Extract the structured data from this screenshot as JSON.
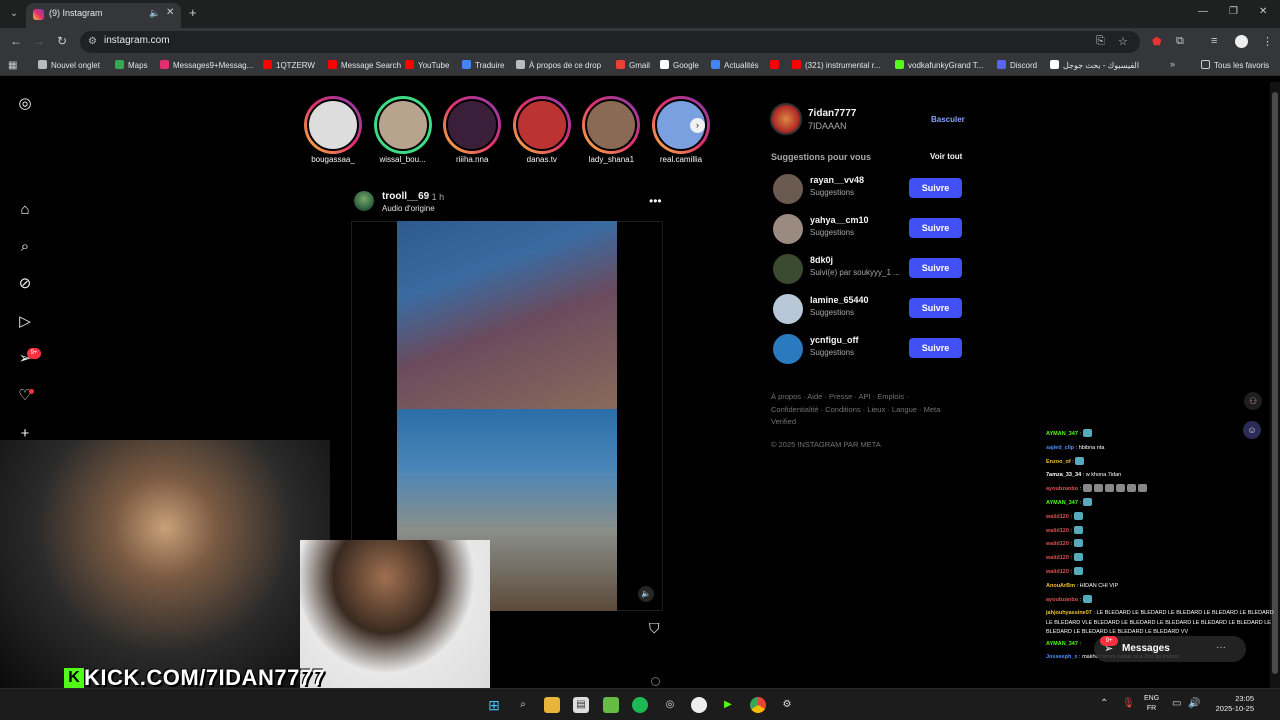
{
  "browser": {
    "tab_title": "(9) Instagram",
    "url": "instagram.com",
    "bookmarks": [
      {
        "label": "Nouvel onglet",
        "color": "#bbbbbb"
      },
      {
        "label": "Maps",
        "color": "#34a853"
      },
      {
        "label": "Messages9+Messag...",
        "color": "#e1306c"
      },
      {
        "label": "1QTZERW",
        "color": "#ff0000"
      },
      {
        "label": "Message Search",
        "color": "#ff0000"
      },
      {
        "label": "YouTube",
        "color": "#ff0000"
      },
      {
        "label": "Traduire",
        "color": "#4285f4"
      },
      {
        "label": "À propos de ce drop",
        "color": "#bbbbbb"
      },
      {
        "label": "Gmail",
        "color": "#ea4335"
      },
      {
        "label": "Google",
        "color": "#ffffff"
      },
      {
        "label": "Actualités",
        "color": "#4285f4"
      },
      {
        "label": "",
        "color": "#ff0000"
      },
      {
        "label": "(321) instrumental r...",
        "color": "#ff0000"
      },
      {
        "label": "vodkafunkyGrand T...",
        "color": "#53fc18"
      },
      {
        "label": "Discord",
        "color": "#5865f2"
      },
      {
        "label": "الفيسبوك - بحث جوجل",
        "color": "#ffffff"
      }
    ],
    "all_bookmarks": "Tous les favoris"
  },
  "stories": [
    {
      "name": "bougassaa_",
      "ring": "linear-gradient(45deg,#f9c13a,#e1306c,#833ab4)",
      "fill": "#ddd"
    },
    {
      "name": "wissal_bou...",
      "ring": "#3ddc84",
      "fill": "#b8a48e"
    },
    {
      "name": "riiiha.nna",
      "ring": "linear-gradient(45deg,#f9c13a,#e1306c,#833ab4)",
      "fill": "#3a1e3a"
    },
    {
      "name": "danas.tv",
      "ring": "linear-gradient(45deg,#f9c13a,#e1306c,#833ab4)",
      "fill": "#b33"
    },
    {
      "name": "lady_shana1",
      "ring": "linear-gradient(45deg,#f9c13a,#e1306c,#833ab4)",
      "fill": "#8a6a55"
    },
    {
      "name": "real.camillia",
      "ring": "linear-gradient(45deg,#f9c13a,#e1306c,#833ab4)",
      "fill": "#7aa0e0"
    }
  ],
  "post": {
    "username": "trooll__69",
    "time": "• 1 h",
    "audio": "Audio d'origine"
  },
  "profile": {
    "username": "7idan7777",
    "name": "7IDAAAN",
    "switch_label": "Basculer"
  },
  "suggestions": {
    "title": "Suggestions pour vous",
    "see_all": "Voir tout",
    "follow_label": "Suivre",
    "items": [
      {
        "username": "rayan__vv48",
        "sub": "Suggestions",
        "color": "#6a5a50"
      },
      {
        "username": "yahya__cm10",
        "sub": "Suggestions",
        "color": "#9a8a80"
      },
      {
        "username": "8dk0j",
        "sub": "Suivi(e) par soukyyy_1 ...",
        "color": "#3a4a30"
      },
      {
        "username": "lamine_65440",
        "sub": "Suggestions",
        "color": "#b8c8d8"
      },
      {
        "username": "ycnfigu_off",
        "sub": "Suggestions",
        "color": "#2a7ac0"
      }
    ]
  },
  "footer": {
    "links": "À propos · Aide · Presse · API · Emplois · Confidentialité · Conditions · Lieux · Langue · Meta Verified",
    "copyright": "© 2025 INSTAGRAM PAR META"
  },
  "overlay": {
    "kick": "KICK.COM/7IDAN7777"
  },
  "chat": [
    {
      "user": "AYMAN_347",
      "color": "#53fc18",
      "text": ":",
      "emotes": 1
    },
    {
      "user": "sajied_clip",
      "color": "#4f8fff",
      "text": ": hbibna nta",
      "emotes": 0
    },
    {
      "user": "Enzoo_of",
      "color": "#f0c030",
      "text": ":",
      "emotes": 1
    },
    {
      "user": "7amza_33_34",
      "color": "#ffffff",
      "text": ": w khona 7idan",
      "emotes": 0
    },
    {
      "user": "ayoubzanbo",
      "color": "#e05050",
      "text": ":",
      "emotes": 6
    },
    {
      "user": "AYMAN_347",
      "color": "#53fc18",
      "text": ":",
      "emotes": 1
    },
    {
      "user": "walid120",
      "color": "#e05050",
      "text": ":",
      "emotes": 1
    },
    {
      "user": "walid120",
      "color": "#e05050",
      "text": ":",
      "emotes": 1
    },
    {
      "user": "walid120",
      "color": "#e05050",
      "text": ":",
      "emotes": 1
    },
    {
      "user": "walid120",
      "color": "#e05050",
      "text": ":",
      "emotes": 1
    },
    {
      "user": "walid120",
      "color": "#e05050",
      "text": ":",
      "emotes": 1
    },
    {
      "user": "AnouArBm",
      "color": "#f0c030",
      "text": ": HIDAN CHI VIP",
      "emotes": 0
    },
    {
      "user": "ayoubzanbo",
      "color": "#e05050",
      "text": ":",
      "emotes": 1
    }
  ],
  "chat_long": {
    "user": "jahjouhyassine07",
    "color": "#f0c030",
    "text": ": LE BLEDARD LE BLEDARD LE BLEDARD LE BLEDARD LE BLEDARD LE BLEDARD VLE BLEDARD LE BLEDARD LE BLEDARD LE BLEDARD LE BLEDARD LE BLEDARD LE BLEDARD LE BLEDARD LE BLEDARD VV"
  },
  "chat_tail": [
    {
      "user": "AYMAN_347",
      "color": "#53fc18",
      "text": ":"
    },
    {
      "user": "Josseeph_x",
      "color": "#4f8fff",
      "text": ": makhot mmm nadak nt a 2nd bg khdem"
    }
  ],
  "messages": {
    "label": "Messages",
    "badge": "9+"
  },
  "rail_badge": "9+",
  "taskbar": {
    "lang_top": "ENG",
    "lang_bottom": "FR",
    "time": "23:05",
    "date": "2025-10-25"
  }
}
